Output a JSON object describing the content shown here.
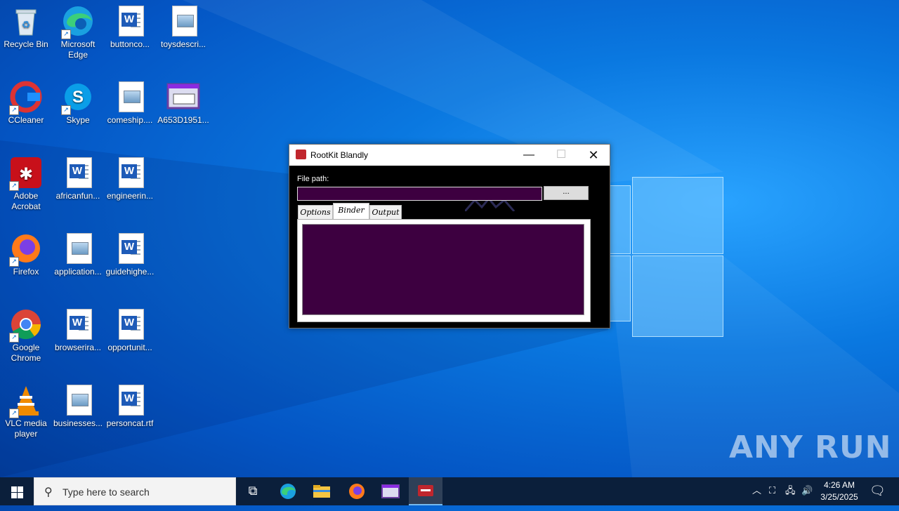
{
  "desktop": {
    "icons": [
      {
        "label": "Recycle Bin"
      },
      {
        "label": "Microsoft Edge"
      },
      {
        "label": "buttonco..."
      },
      {
        "label": "toysdescri..."
      },
      {
        "label": "CCleaner"
      },
      {
        "label": "Skype"
      },
      {
        "label": "comeship...."
      },
      {
        "label": "A653D1951..."
      },
      {
        "label": "Adobe Acrobat"
      },
      {
        "label": "africanfun..."
      },
      {
        "label": "engineerin..."
      },
      {
        "label": "Firefox"
      },
      {
        "label": "application..."
      },
      {
        "label": "guidehighe..."
      },
      {
        "label": "Google Chrome"
      },
      {
        "label": "browserira..."
      },
      {
        "label": "opportunit..."
      },
      {
        "label": "VLC media player"
      },
      {
        "label": "businesses..."
      },
      {
        "label": "personcat.rtf"
      }
    ]
  },
  "window": {
    "title": "RootKit Blandly",
    "minimize": "—",
    "maximize": "☐",
    "close": "✕",
    "file_path_label": "File path:",
    "file_path_value": "",
    "browse_label": "...",
    "tabs": [
      {
        "label": "Options"
      },
      {
        "label": "Binder"
      },
      {
        "label": "Output"
      }
    ],
    "active_tab": "Binder"
  },
  "taskbar": {
    "search_placeholder": "Type here to search",
    "time": "4:26 AM",
    "date": "3/25/2025"
  },
  "watermark": "ANY RUN",
  "colors": {
    "accent_purple": "#3d0040",
    "taskbar": "#0b1f3b",
    "desktop_blue": "#0a78e0"
  }
}
